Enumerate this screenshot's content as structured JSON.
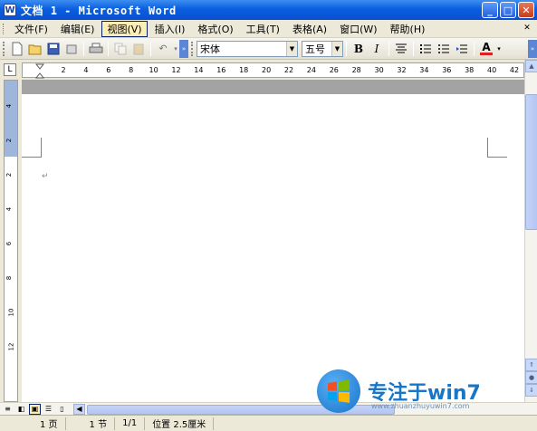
{
  "window": {
    "title": "文档 1 - Microsoft Word",
    "app_icon_letter": "W"
  },
  "menubar": {
    "items": [
      "文件(F)",
      "编辑(E)",
      "视图(V)",
      "插入(I)",
      "格式(O)",
      "工具(T)",
      "表格(A)",
      "窗口(W)",
      "帮助(H)"
    ],
    "active_index": 2
  },
  "toolbar": {
    "font_name": "宋体",
    "font_size": "五号",
    "bold": "B",
    "italic": "I",
    "font_color_label": "A",
    "font_color": "#e02020"
  },
  "ruler": {
    "marks": [
      "2",
      "4",
      "6",
      "8",
      "10",
      "12",
      "14",
      "16",
      "18",
      "20",
      "22",
      "24",
      "26",
      "28",
      "30",
      "32",
      "34",
      "36",
      "38",
      "40",
      "42"
    ],
    "vertical_marks": [
      "4",
      "2",
      "2",
      "4",
      "6",
      "8",
      "10",
      "12"
    ]
  },
  "document": {
    "paragraph_mark": "↵"
  },
  "status": {
    "page": "1 页",
    "section": "1 节",
    "page_count": "1/1",
    "position": "位置 2.5厘米"
  },
  "watermark": {
    "text": "专注于win7",
    "url": "www.zhuanzhuyuwin7.com"
  },
  "colors": {
    "title_bar": "#0a5fe0",
    "menu_active": "#fdeeb8",
    "page_background": "#ffffff"
  }
}
